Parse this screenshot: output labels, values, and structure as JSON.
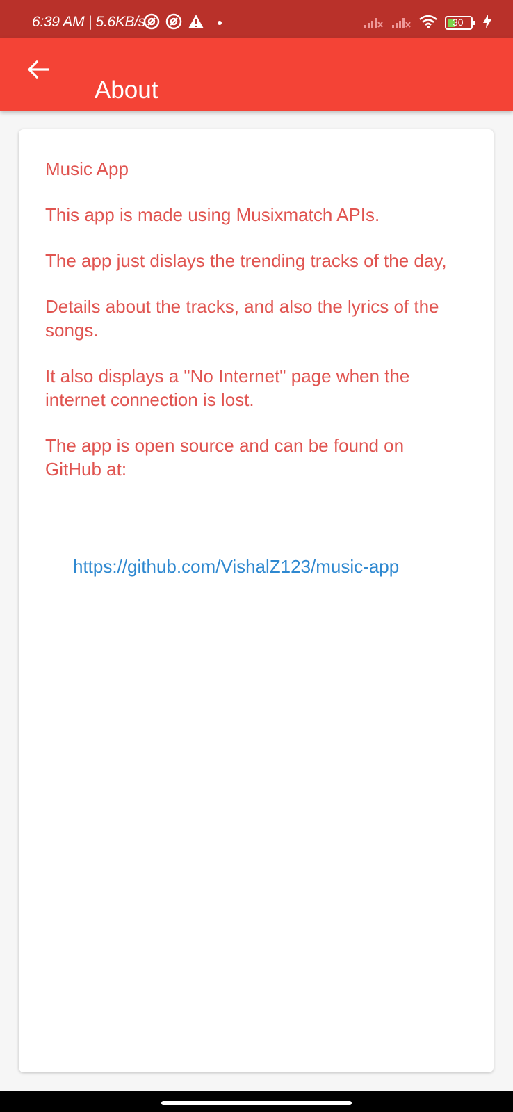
{
  "status_bar": {
    "time": "6:39 AM | 5.6KB/s",
    "battery": "30",
    "icons": [
      "at-sign-icon",
      "at-sign-icon",
      "warning-icon",
      "dot-icon",
      "signal-icon",
      "signal-icon",
      "wifi-icon",
      "battery-icon",
      "charging-icon"
    ]
  },
  "app_bar": {
    "title": "About",
    "back_icon": "arrow-left-icon",
    "color": "#f44336"
  },
  "content": {
    "paragraphs": [
      "Music App",
      "This app is made using Musixmatch APIs.",
      "The app just dislays the trending tracks of the day,",
      "Details about the tracks, and also the lyrics of the songs.",
      "It also displays a \"No Internet\" page when the internet connection is lost.",
      "The app is open source and can be found on GitHub at:"
    ],
    "link": "https://github.com/VishalZ123/music-app",
    "text_color": "#e05450",
    "link_color": "#2e88d0"
  }
}
